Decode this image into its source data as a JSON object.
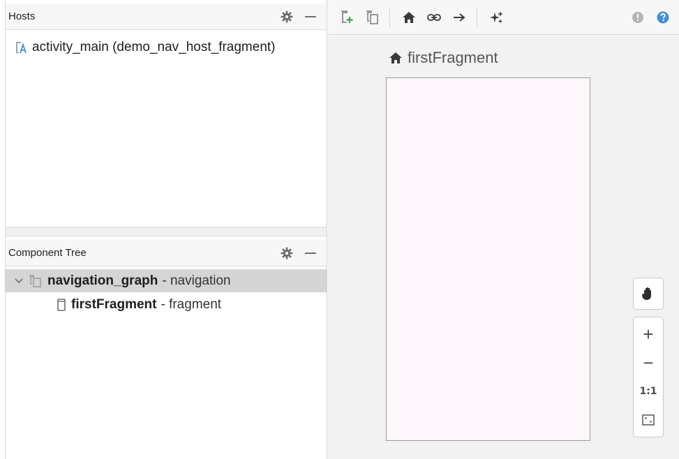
{
  "hosts": {
    "title": "Hosts",
    "items": [
      {
        "label": "activity_main (demo_nav_host_fragment)"
      }
    ]
  },
  "component_tree": {
    "title": "Component Tree",
    "rows": [
      {
        "name": "navigation_graph",
        "type": "- navigation"
      },
      {
        "name": "firstFragment",
        "type": "- fragment"
      }
    ]
  },
  "design": {
    "start_destination_label": "firstFragment",
    "zoom_actual_size_label": "1:1",
    "zoom_in_label": "+",
    "zoom_out_label": "−"
  },
  "colors": {
    "accent_blue": "#3d8fd9",
    "add_green": "#4fa35a",
    "selection_gray": "#d5d5d5",
    "fragment_fill": "#fdf6fb"
  },
  "icons": {
    "toolbar": [
      "new-destination-icon",
      "nested-graph-icon",
      "home-icon",
      "link-icon",
      "action-arrow-icon",
      "auto-arrange-icon",
      "warning-icon",
      "help-icon"
    ],
    "panel": [
      "gear-icon",
      "minimize-icon"
    ]
  }
}
